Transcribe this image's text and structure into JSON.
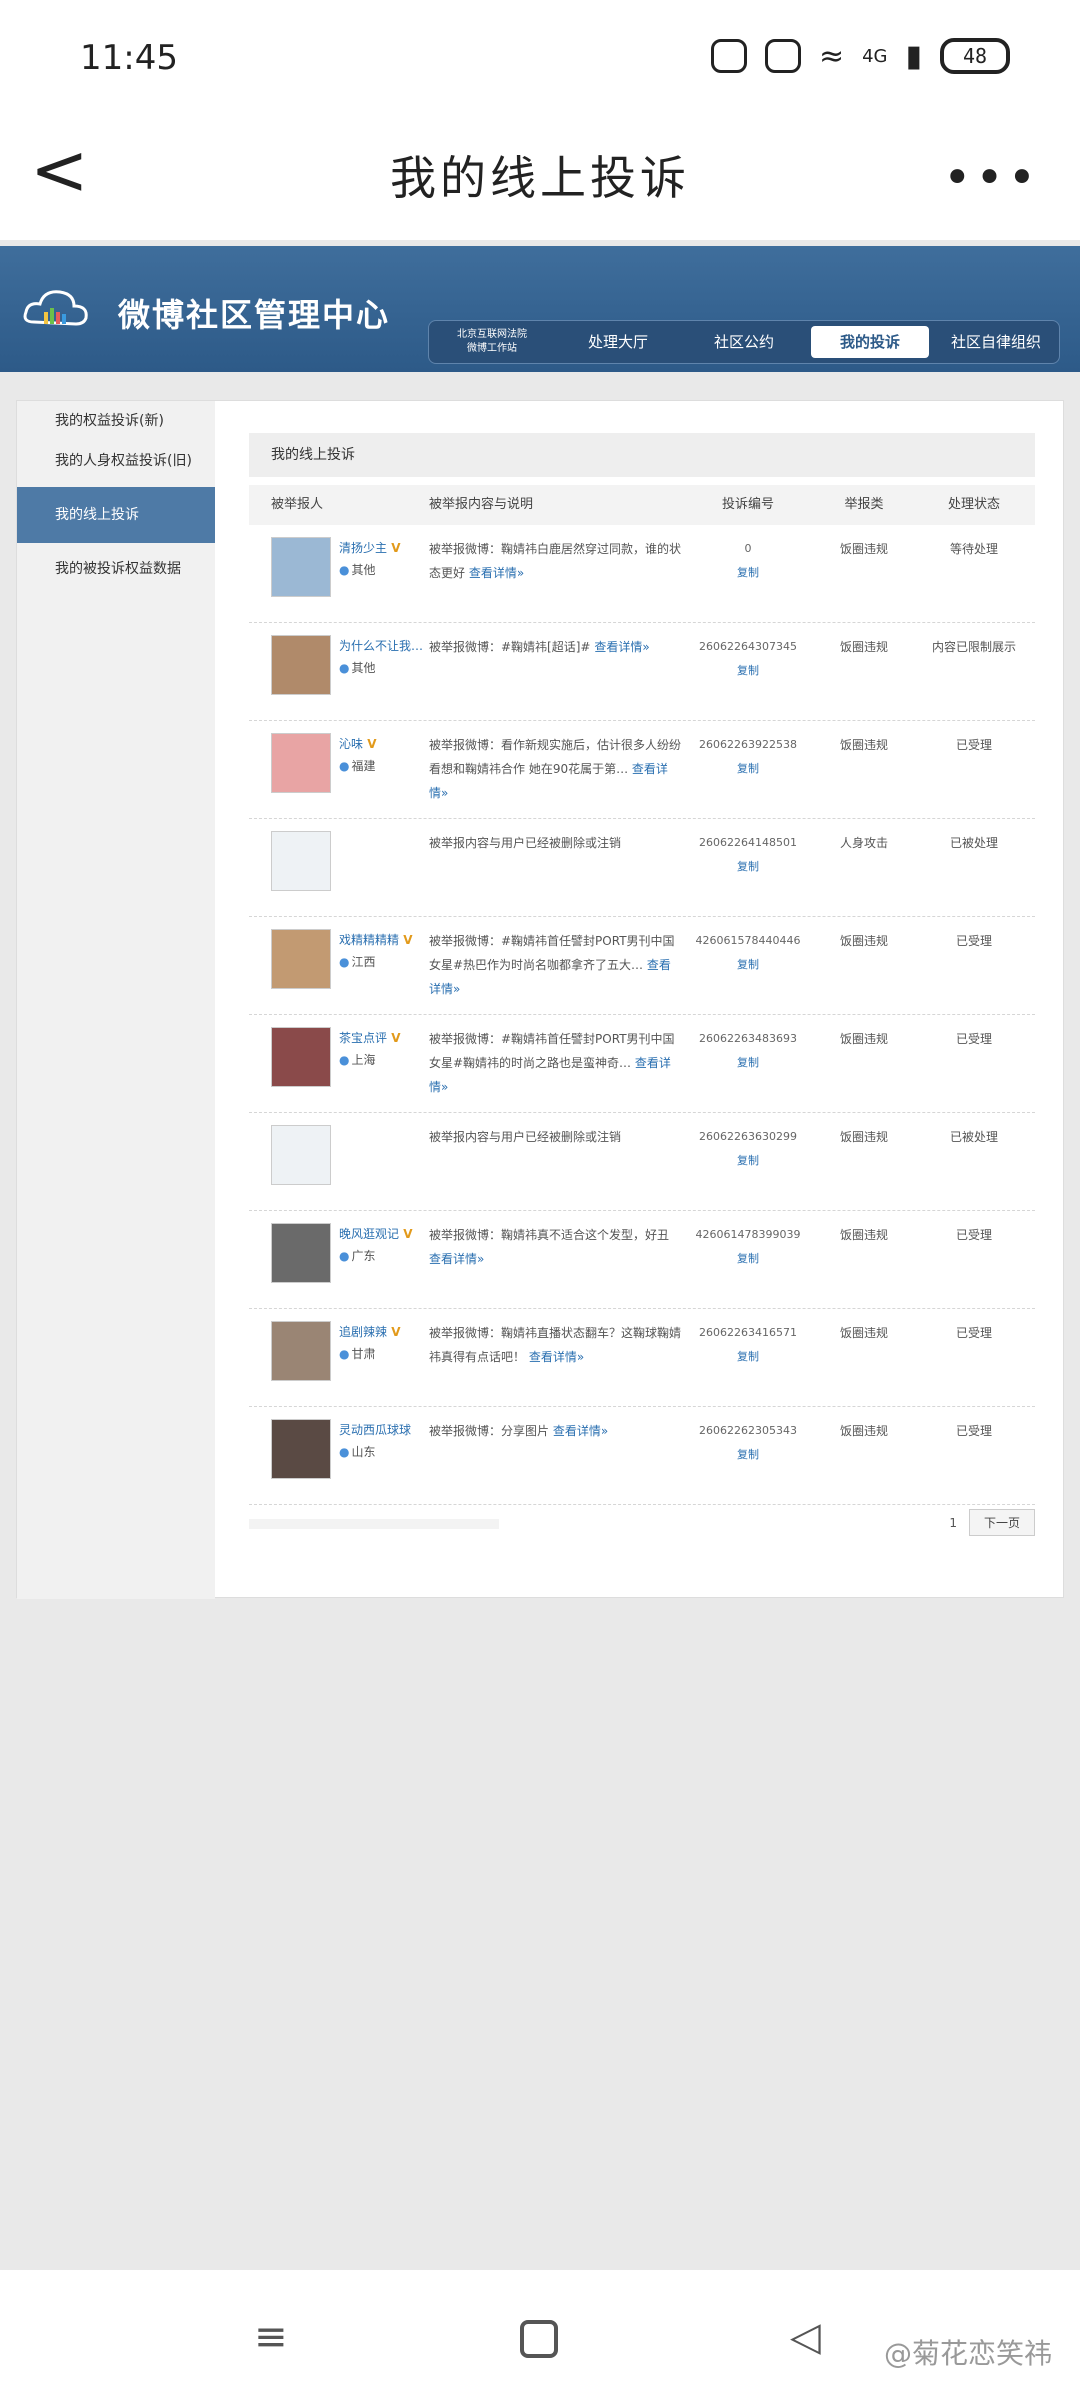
{
  "status": {
    "time": "11:45",
    "battery": "48",
    "network": "4G"
  },
  "titlebar": {
    "title": "我的线上投诉",
    "back": "<",
    "more": "•••"
  },
  "site": {
    "name": "微博社区管理中心",
    "nav": [
      {
        "label": "北京互联网法院\n微博工作站",
        "small": true
      },
      {
        "label": "处理大厅"
      },
      {
        "label": "社区公约"
      },
      {
        "label": "我的投诉",
        "active": true
      },
      {
        "label": "社区自律组织"
      }
    ]
  },
  "sidebar": [
    {
      "label": "我的权益投诉(新)"
    },
    {
      "label": "我的人身权益投诉(旧)"
    },
    {
      "label": "我的线上投诉",
      "active": true
    },
    {
      "label": "我的被投诉权益数据"
    }
  ],
  "main": {
    "title": "我的线上投诉",
    "headers": [
      "被举报人",
      "被举报内容与说明",
      "投诉编号",
      "举报类",
      "处理状态"
    ],
    "rows": [
      {
        "name": "清扬少主",
        "verified": true,
        "loc": "其他",
        "desc": "被举报微博：鞠婧祎白鹿居然穿过同款，谁的状态更好",
        "link": "查看详情»",
        "num": "0",
        "copy": "复制",
        "type": "饭圈违规",
        "state": "等待处理",
        "avatar": "#9bb8d4"
      },
      {
        "name": "为什么不让我…",
        "verified": false,
        "loc": "其他",
        "desc": "被举报微博：#鞠婧祎[超话]#",
        "link": "查看详情»",
        "num": "260622643073​45",
        "copy": "复制",
        "type": "饭圈违规",
        "state": "内容已限制展示",
        "avatar": "#b08a6a"
      },
      {
        "name": "沁味",
        "verified": true,
        "loc": "福建",
        "desc": "被举报微博：看作新规实施后，估计很多人纷纷看想和鞠婧祎合作 她在90花属于第…",
        "link": "查看详情»",
        "num": "260622639225​38",
        "copy": "复制",
        "type": "饭圈违规",
        "state": "已受理",
        "avatar": "#e8a4a4"
      },
      {
        "name": "",
        "verified": false,
        "loc": "",
        "desc": "被举报内容与用户已经被删除或注销",
        "link": "",
        "num": "26062264148501",
        "copy": "复制",
        "type": "人身攻击",
        "state": "已被处理",
        "avatar": ""
      },
      {
        "name": "戏精精精精",
        "verified": true,
        "loc": "江西",
        "desc": "被举报微博：#鞠婧祎首任譬封PORT男刊中国女星#热巴作为时尚名咖都拿齐了五大…",
        "link": "查看详情»",
        "num": "426061578440446",
        "copy": "复制",
        "type": "饭圈违规",
        "state": "已受理",
        "avatar": "#c29a72"
      },
      {
        "name": "茶宝点评",
        "verified": true,
        "loc": "上海",
        "desc": "被举报微博：#鞠婧祎首任譬封PORT男刊中国女星#鞠婧祎的时尚之路也是蛮神奇…",
        "link": "查看详情»",
        "num": "26062263483693",
        "copy": "复制",
        "type": "饭圈违规",
        "state": "已受理",
        "avatar": "#8a4a4a"
      },
      {
        "name": "",
        "verified": false,
        "loc": "",
        "desc": "被举报内容与用户已经被删除或注销",
        "link": "",
        "num": "26062263630299",
        "copy": "复制",
        "type": "饭圈违规",
        "state": "已被处理",
        "avatar": ""
      },
      {
        "name": "晚风逛观记",
        "verified": true,
        "loc": "广东",
        "desc": "被举报微博：鞠婧祎真不适合这个发型，好丑",
        "link": "查看详情»",
        "num": "426061478399039",
        "copy": "复制",
        "type": "饭圈违规",
        "state": "已受理",
        "avatar": "#6a6a6a"
      },
      {
        "name": "追剧辣辣",
        "verified": true,
        "loc": "甘肃",
        "desc": "被举报微博：鞠婧祎直播状态翻车？这鞠球鞠婧祎真得有点话吧！",
        "link": "查看详情»",
        "num": "26062263416571",
        "copy": "复制",
        "type": "饭圈违规",
        "state": "已受理",
        "avatar": "#9a8574"
      },
      {
        "name": "灵动西瓜球球",
        "verified": false,
        "loc": "山东",
        "desc": "被举报微博：分享图片",
        "link": "查看详情»",
        "num": "26062262305343",
        "copy": "复制",
        "type": "饭圈违规",
        "state": "已受理",
        "avatar": "#5a4a44"
      }
    ],
    "pager": {
      "page": "1",
      "next": "下一页"
    }
  },
  "watermark": "@菊花恋笑祎"
}
